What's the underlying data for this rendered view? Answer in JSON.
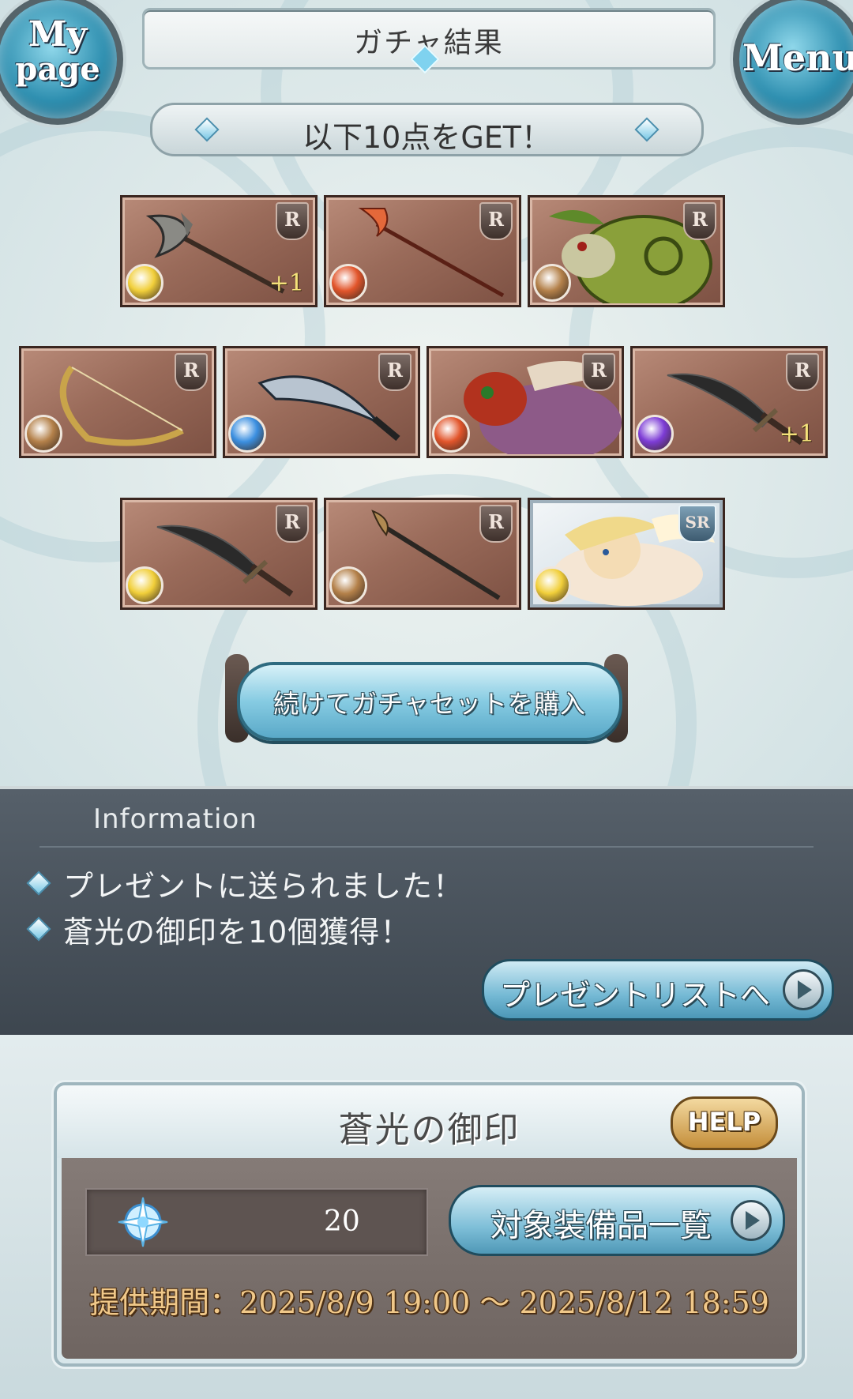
{
  "header": {
    "title": "ガチャ結果",
    "mypage_line1": "My",
    "mypage_line2": "page",
    "menu_label": "Menu"
  },
  "banner": {
    "text": "以下10点をGET！"
  },
  "results": [
    {
      "rarity": "R",
      "element": "light",
      "item": "axe",
      "plus": "+1"
    },
    {
      "rarity": "R",
      "element": "fire",
      "item": "spear",
      "plus": ""
    },
    {
      "rarity": "R",
      "element": "earth",
      "item": "summon-creature",
      "plus": ""
    },
    {
      "rarity": "R",
      "element": "earth",
      "item": "bow",
      "plus": ""
    },
    {
      "rarity": "R",
      "element": "water",
      "item": "blade",
      "plus": ""
    },
    {
      "rarity": "R",
      "element": "fire",
      "item": "summon-bird",
      "plus": ""
    },
    {
      "rarity": "R",
      "element": "dark",
      "item": "sword",
      "plus": "+1"
    },
    {
      "rarity": "R",
      "element": "light",
      "item": "sword",
      "plus": ""
    },
    {
      "rarity": "R",
      "element": "earth",
      "item": "staff",
      "plus": ""
    },
    {
      "rarity": "SR",
      "element": "light",
      "item": "summon-character",
      "plus": ""
    }
  ],
  "buy_again": {
    "label": "続けてガチャセットを購入"
  },
  "information": {
    "heading": "Information",
    "lines": [
      "プレゼントに送られました！",
      "蒼光の御印を10個獲得！"
    ],
    "present_button": "プレゼントリストへ"
  },
  "seal": {
    "title": "蒼光の御印",
    "help": "HELP",
    "count": "20",
    "list_button": "対象装備品一覧",
    "period": "提供期間：2025/8/9 19:00 〜 2025/8/12 18:59"
  },
  "colors": {
    "light": "#f1cf3a",
    "fire": "#e2552b",
    "earth": "#b4814a",
    "water": "#3b8fe0",
    "dark": "#7d3cd6"
  }
}
